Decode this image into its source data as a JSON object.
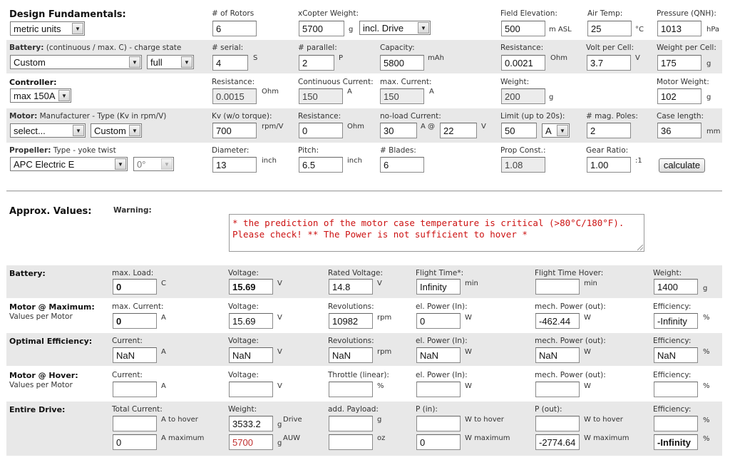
{
  "design": {
    "title": "Design Fundamentals:",
    "units": "metric units",
    "rotors_label": "# of Rotors",
    "rotors": "6",
    "weight_label": "xCopter Weight:",
    "weight": "5700",
    "weight_unit": "g",
    "weight_mode": "incl. Drive",
    "elev_label": "Field Elevation:",
    "elev": "500",
    "elev_unit": "m ASL",
    "temp_label": "Air Temp:",
    "temp": "25",
    "temp_unit": "°C",
    "press_label": "Pressure (QNH):",
    "press": "1013",
    "press_unit": "hPa"
  },
  "battery": {
    "title": "Battery:",
    "subtitle": "(continuous / max. C) - charge state",
    "type": "Custom",
    "charge": "full",
    "serial_label": "# serial:",
    "serial": "4",
    "serial_unit": "S",
    "parallel_label": "# parallel:",
    "parallel": "2",
    "parallel_unit": "P",
    "capacity_label": "Capacity:",
    "capacity": "5800",
    "capacity_unit": "mAh",
    "res_label": "Resistance:",
    "res": "0.0021",
    "res_unit": "Ohm",
    "volt_label": "Volt per Cell:",
    "volt": "3.7",
    "volt_unit": "V",
    "wpc_label": "Weight per Cell:",
    "wpc": "175",
    "wpc_unit": "g"
  },
  "controller": {
    "title": "Controller:",
    "type": "max 150A",
    "res_label": "Resistance:",
    "res": "0.0015",
    "res_unit": "Ohm",
    "cont_label": "Continuous Current:",
    "cont": "150",
    "cont_unit": "A",
    "max_label": "max. Current:",
    "max": "150",
    "max_unit": "A",
    "weight_label": "Weight:",
    "weight": "200",
    "weight_unit": "g",
    "motor_weight_label": "Motor Weight:",
    "motor_weight": "102",
    "motor_weight_unit": "g"
  },
  "motor": {
    "title": "Motor:",
    "subtitle": "Manufacturer - Type (Kv in rpm/V)",
    "manufacturer": "select...",
    "type": "Custom",
    "kv_label": "Kv (w/o torque):",
    "kv": "700",
    "kv_unit": "rpm/V",
    "res_label": "Resistance:",
    "res": "0",
    "res_unit": "Ohm",
    "noload_label": "no-load Current:",
    "noload": "30",
    "noload_unit": "A @",
    "noload_v": "22",
    "noload_v_unit": "V",
    "limit_label": "Limit (up to 20s):",
    "limit": "50",
    "limit_unit": "A",
    "poles_label": "# mag. Poles:",
    "poles": "2",
    "case_label": "Case length:",
    "case": "36",
    "case_unit": "mm"
  },
  "propeller": {
    "title": "Propeller:",
    "subtitle": "Type - yoke twist",
    "type": "APC Electric E",
    "twist": "0°",
    "dia_label": "Diameter:",
    "dia": "13",
    "dia_unit": "inch",
    "pitch_label": "Pitch:",
    "pitch": "6.5",
    "pitch_unit": "inch",
    "blades_label": "# Blades:",
    "blades": "6",
    "const_label": "Prop Const.:",
    "const": "1.08",
    "gear_label": "Gear Ratio:",
    "gear": "1.00",
    "gear_unit": ":1",
    "calculate": "calculate"
  },
  "approx": {
    "title": "Approx. Values:",
    "warning_label": "Warning:",
    "warning": "* the prediction of the motor case temperature is critical (>80°C/180°F). Please check! ** The Power is not sufficient to hover *"
  },
  "res_battery": {
    "title": "Battery:",
    "load_label": "max. Load:",
    "load": "0",
    "load_unit": "C",
    "volt_label": "Voltage:",
    "volt": "15.69",
    "volt_unit": "V",
    "rated_label": "Rated Voltage:",
    "rated": "14.8",
    "rated_unit": "V",
    "ft_label": "Flight Time*:",
    "ft": "Infinity",
    "ft_unit": "min",
    "fth_label": "Flight Time Hover:",
    "fth": "",
    "fth_unit": "min",
    "weight_label": "Weight:",
    "weight": "1400",
    "weight_unit": "g"
  },
  "res_max": {
    "title": "Motor @ Maximum:",
    "sub": "Values per Motor",
    "cur_label": "max. Current:",
    "cur": "0",
    "cur_unit": "A",
    "volt_label": "Voltage:",
    "volt": "15.69",
    "volt_unit": "V",
    "rev_label": "Revolutions:",
    "rev": "10982",
    "rev_unit": "rpm",
    "pin_label": "el. Power (In):",
    "pin": "0",
    "pin_unit": "W",
    "pout_label": "mech. Power (out):",
    "pout": "-462.44",
    "pout_unit": "W",
    "eff_label": "Efficiency:",
    "eff": "-Infinity",
    "eff_unit": "%"
  },
  "res_opt": {
    "title": "Optimal Efficiency:",
    "cur_label": "Current:",
    "cur": "NaN",
    "cur_unit": "A",
    "volt_label": "Voltage:",
    "volt": "NaN",
    "volt_unit": "V",
    "rev_label": "Revolutions:",
    "rev": "NaN",
    "rev_unit": "rpm",
    "pin_label": "el. Power (In):",
    "pin": "NaN",
    "pin_unit": "W",
    "pout_label": "mech. Power (out):",
    "pout": "NaN",
    "pout_unit": "W",
    "eff_label": "Efficiency:",
    "eff": "NaN",
    "eff_unit": "%"
  },
  "res_hover": {
    "title": "Motor @ Hover:",
    "sub": "Values per Motor",
    "cur_label": "Current:",
    "cur": "",
    "cur_unit": "A",
    "volt_label": "Voltage:",
    "volt": "",
    "volt_unit": "V",
    "thr_label": "Throttle (linear):",
    "thr": "",
    "thr_unit": "%",
    "pin_label": "el. Power (In):",
    "pin": "",
    "pin_unit": "W",
    "pout_label": "mech. Power (out):",
    "pout": "",
    "pout_unit": "W",
    "eff_label": "Efficiency:",
    "eff": "",
    "eff_unit": "%"
  },
  "res_drive": {
    "title": "Entire Drive:",
    "cur_label": "Total Current:",
    "cur_hover": "",
    "cur_hover_unit": "A to hover",
    "cur_max": "0",
    "cur_max_unit": "A maximum",
    "weight_label": "Weight:",
    "weight_drive": "3533.2",
    "weight_drive_unit": "g",
    "weight_drive_tag": "Drive",
    "weight_auw": "5700",
    "weight_auw_unit": "g",
    "weight_auw_tag": "AUW",
    "payload_label": "add. Payload:",
    "payload_g": "",
    "payload_g_unit": "g",
    "payload_oz": "",
    "payload_oz_unit": "oz",
    "pin_label": "P (in):",
    "pin_hover": "",
    "pin_hover_unit": "W to hover",
    "pin_max": "0",
    "pin_max_unit": "W maximum",
    "pout_label": "P (out):",
    "pout_hover": "",
    "pout_hover_unit": "W to hover",
    "pout_max": "-2774.64",
    "pout_max_unit": "W maximum",
    "eff_label": "Efficiency:",
    "eff_hover": "",
    "eff_hover_unit": "%",
    "eff_max": "-Infinity",
    "eff_max_unit": "%"
  }
}
